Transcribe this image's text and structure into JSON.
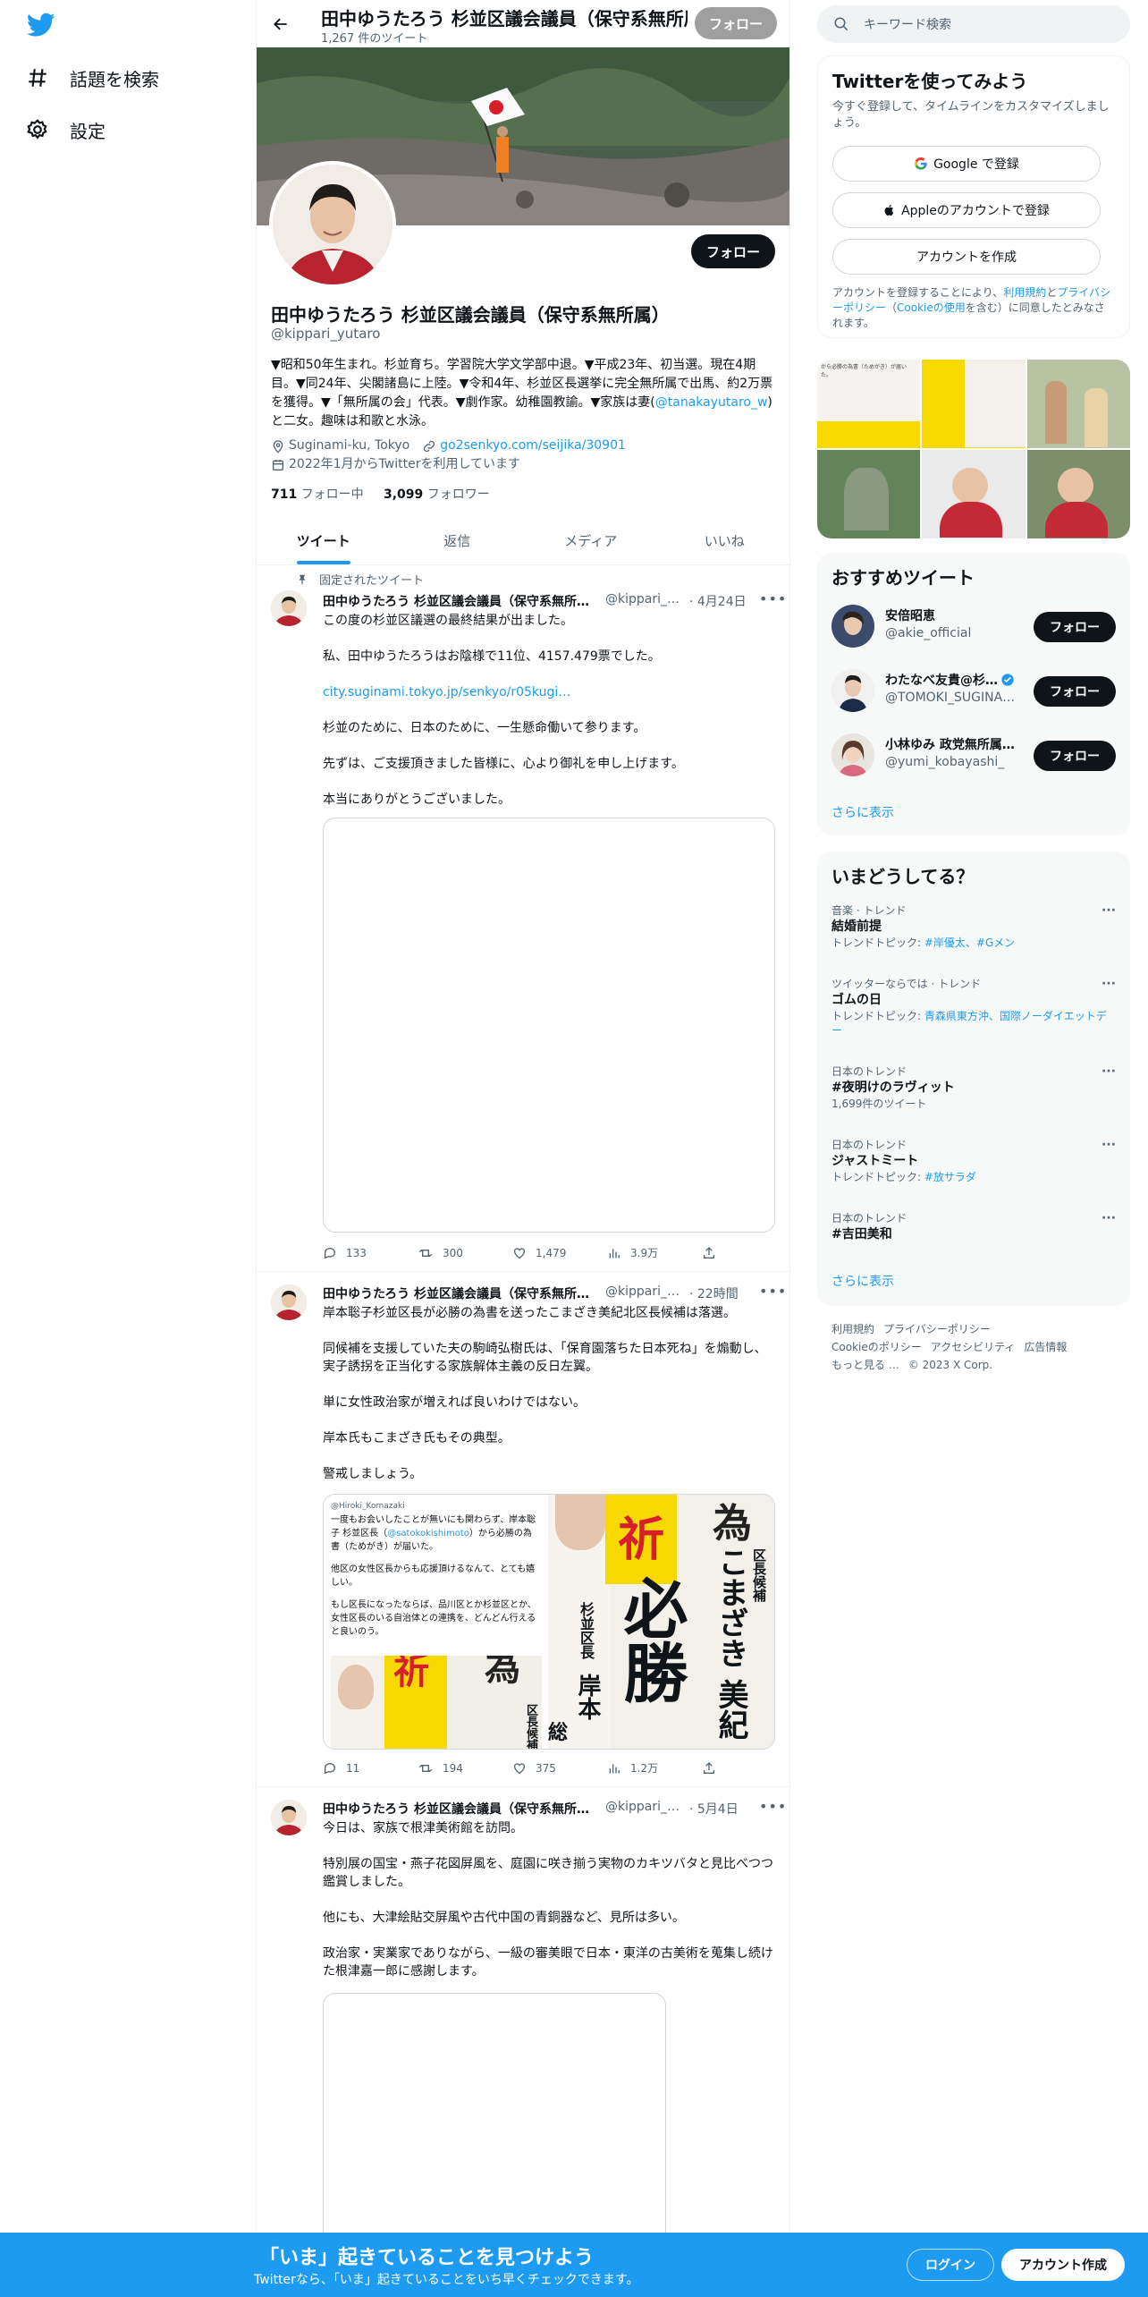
{
  "nav": {
    "explore": "話題を検索",
    "settings": "設定"
  },
  "profile": {
    "header_name": "田中ゆうたろう 杉並区議会議員（保守系無所属）",
    "tweet_count": "1,267 件のツイート",
    "follow": "フォロー",
    "name": "田中ゆうたろう 杉並区議会議員（保守系無所属）",
    "handle": "@kippari_yutaro",
    "bio_pre": "▼昭和50年生まれ。杉並育ち。学習院大学文学部中退。▼平成23年、初当選。現在4期目。▼同24年、尖閣諸島に上陸。▼令和4年、杉並区長選挙に完全無所属で出馬、約2万票を獲得。▼「無所属の会」代表。▼劇作家。幼稚園教諭。▼家族は妻(",
    "bio_link": "@tanakayutaro_w",
    "bio_post": ")と二女。趣味は和歌と水泳。",
    "location": "Suginami-ku, Tokyo",
    "url": "go2senkyo.com/seijika/30901",
    "joined": "2022年1月からTwitterを利用しています",
    "following_count": "711",
    "following_label": "フォロー中",
    "followers_count": "3,099",
    "followers_label": "フォロワー"
  },
  "tabs": [
    "ツイート",
    "返信",
    "メディア",
    "いいね"
  ],
  "pinned_label": "固定されたツイート",
  "tweets": [
    {
      "name": "田中ゆうたろう 杉並区議会議員（保守系無所属）",
      "handle": "@kippari_yutaro",
      "date": "· 4月24日",
      "lines": [
        "この度の杉並区議選の最終結果が出ました。",
        "私、田中ゆうたろうはお陰様で11位、4157.479票でした。",
        "",
        "杉並のために、日本のために、一生懸命働いて参ります。",
        "先ずは、ご支援頂きました皆様に、心より御礼を申し上げます。",
        "本当にありがとうございました。"
      ],
      "link": "city.suginami.tokyo.jp/senkyo/r05kugi…",
      "replies": "133",
      "retweets": "300",
      "likes": "1,479",
      "views": "3.9万"
    },
    {
      "name": "田中ゆうたろう 杉並区議会議員（保守系無所属）",
      "handle": "@kippari_yutaro",
      "date": "· 22時間",
      "lines": [
        "岸本聡子杉並区長が必勝の為書を送ったこまざき美紀北区長候補は落選。",
        "同候補を支援していた夫の駒崎弘樹氏は、「保育園落ちた日本死ね」を煽動し、実子誘拐を正当化する家族解体主義の反日左翼。",
        "単に女性政治家が増えれば良いわけではない。",
        "岸本氏もこまざき氏もその典型。",
        "警戒しましょう。"
      ],
      "replies": "11",
      "retweets": "194",
      "likes": "375",
      "views": "1.2万",
      "media_handle": "@Hiroki_Komazaki",
      "media_text_1": "一度もお会いしたことが無いにも関わらず、岸本聡子 杉並区長（",
      "media_link": "@satokokishimoto",
      "media_text_2": "）から必勝の為書（ためがき）が届いた。",
      "media_text_3": "他区の女性区長からも応援頂けるなんて、とても嬉しい。",
      "media_text_4": "もし区長になったならば、品川区とか杉並区とか、女性区長のいる自治体との連携を、どんどん行えると良いのう。",
      "poster_1": "祈",
      "poster_2": "為",
      "poster_3": "区長候補",
      "poster_4": "杉並区長",
      "poster_5": "岸本",
      "poster_6": "必勝",
      "poster_7": "こまざき 美紀",
      "poster_8": "総"
    },
    {
      "name": "田中ゆうたろう 杉並区議会議員（保守系無所属）",
      "handle": "@kippari_yutaro",
      "date": "· 5月4日",
      "lines": [
        "今日は、家族で根津美術館を訪問。",
        "特別展の国宝・燕子花図屏風を、庭園に咲き揃う実物のカキツバタと見比べつつ鑑賞しました。",
        "他にも、大津絵貼交屏風や古代中国の青銅器など、見所は多い。",
        "政治家・実業家でありながら、一級の審美眼で日本・東洋の古美術を蒐集し続けた根津嘉一郎に感謝します。"
      ]
    }
  ],
  "right": {
    "search_placeholder": "キーワード検索",
    "signup_title": "Twitterを使ってみよう",
    "signup_sub": "今すぐ登録して、タイムラインをカスタマイズしましょう。",
    "google": "Google で登録",
    "apple": "Appleのアカウントで登録",
    "create": "アカウントを作成",
    "legal_1": "アカウントを登録することにより、",
    "legal_terms": "利用規約",
    "legal_2": "と",
    "legal_privacy": "プライバシーポリシー",
    "legal_3": "（",
    "legal_cookie": "Cookieの使用",
    "legal_4": "を含む）に同意したとみなされます。",
    "photo_text": "から必勝の為書（ためがき）が届いた。",
    "rec_title": "おすすめツイート",
    "rec_users": [
      {
        "name": "安倍昭恵",
        "handle": "@akie_official"
      },
      {
        "name": "わたなべ友貴@杉…",
        "handle": "@TOMOKI_SUGINA…"
      },
      {
        "name": "小林ゆみ 政党無所属…",
        "handle": "@yumi_kobayashi_"
      }
    ],
    "show_more": "さらに表示",
    "trends_title": "いまどうしてる？",
    "trends": [
      {
        "cat": "音楽 · トレンド",
        "title": "結婚前提",
        "sub_pre": "トレンドトピック: ",
        "sub_links": "#岸優太、#Gメン"
      },
      {
        "cat": "ツイッターならでは · トレンド",
        "title": "ゴムの日",
        "sub_pre": "トレンドトピック: ",
        "sub_links": "青森県東方沖、国際ノーダイエットデー"
      },
      {
        "cat": "日本のトレンド",
        "title": "#夜明けのラヴィット",
        "sub_pre": "1,699件のツイート",
        "sub_links": ""
      },
      {
        "cat": "日本のトレンド",
        "title": "ジャストミート",
        "sub_pre": "トレンドトピック: ",
        "sub_links": "#放サラダ"
      },
      {
        "cat": "日本のトレンド",
        "title": "#吉田美和",
        "sub_pre": "",
        "sub_links": ""
      }
    ],
    "footer": [
      "利用規約",
      "プライバシーポリシー",
      "Cookieのポリシー",
      "アクセシビリティ",
      "広告情報",
      "もっと見る …",
      "© 2023 X Corp."
    ]
  },
  "bottom": {
    "title": "「いま」起きていることを見つけよう",
    "sub": "Twitterなら、「いま」起きていることをいち早くチェックできます。",
    "login": "ログイン",
    "register": "アカウント作成"
  },
  "colors": {
    "accent": "#1d9bf0",
    "text": "#0f1419",
    "muted": "#536471"
  }
}
